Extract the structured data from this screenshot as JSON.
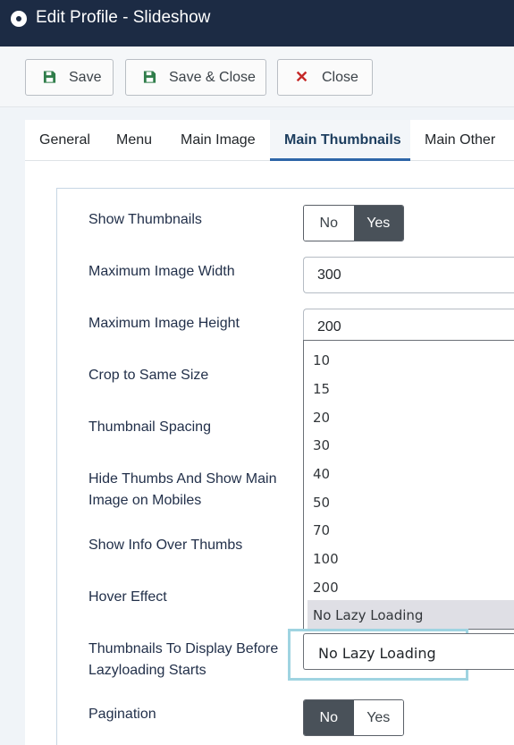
{
  "window": {
    "title": "Edit Profile - Slideshow",
    "icon": "radio-dot-icon"
  },
  "toolbar": {
    "save_label": "Save",
    "save_close_label": "Save & Close",
    "close_label": "Close"
  },
  "tabs": [
    {
      "label": "General"
    },
    {
      "label": "Menu"
    },
    {
      "label": "Main Image"
    },
    {
      "label": "Main Thumbnails"
    },
    {
      "label": "Main Other"
    }
  ],
  "active_tab": "Main Thumbnails",
  "fields": {
    "show_thumbnails": {
      "label": "Show Thumbnails",
      "no": "No",
      "yes": "Yes",
      "value": "Yes"
    },
    "max_width": {
      "label": "Maximum Image Width",
      "value": "300"
    },
    "max_height": {
      "label": "Maximum Image Height",
      "value": "200"
    },
    "crop_same_size": {
      "label": "Crop to Same Size"
    },
    "thumb_spacing": {
      "label": "Thumbnail Spacing"
    },
    "hide_thumbs_line1": "Hide Thumbs And Show Main",
    "hide_thumbs_line2": "Image on Mobiles",
    "show_info": {
      "label": "Show Info Over Thumbs"
    },
    "hover_effect": {
      "label": "Hover Effect"
    },
    "lazy_line1": "Thumbnails To Display Before",
    "lazy_line2": "Lazyloading Starts",
    "lazy_value": "No Lazy Loading",
    "pagination": {
      "label": "Pagination",
      "no": "No",
      "yes": "Yes",
      "value": "No"
    }
  },
  "dropdown_options": [
    "10",
    "15",
    "20",
    "30",
    "40",
    "50",
    "70",
    "100",
    "200",
    "No Lazy Loading"
  ],
  "colors": {
    "titlebar": "#1c2b44",
    "toggle_active": "#495159",
    "tab_accent": "#2e66a8",
    "focus_ring": "#9fd4e1",
    "close_icon": "#c52827",
    "save_icon": "#2f7d4a"
  }
}
